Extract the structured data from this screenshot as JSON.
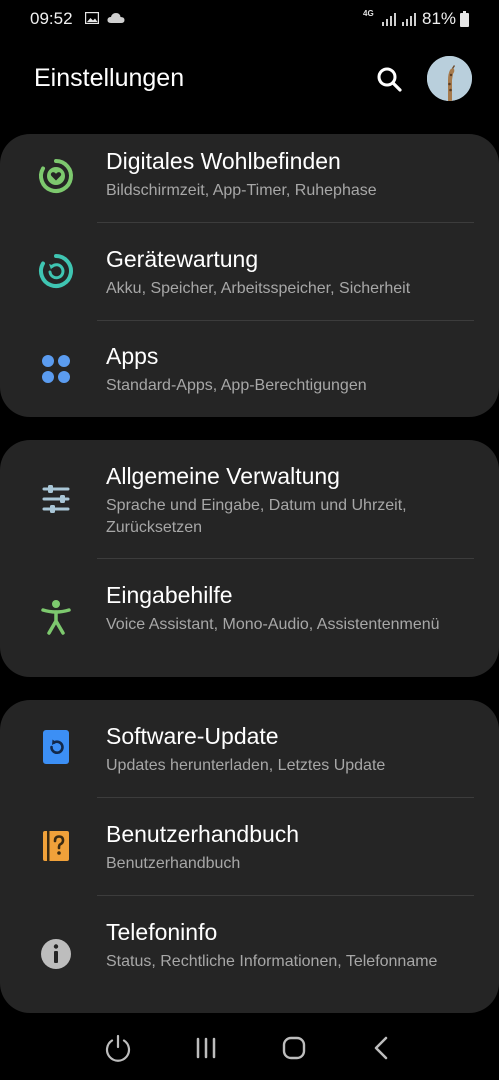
{
  "status_bar": {
    "time": "09:52",
    "network": "4G",
    "battery": "81%",
    "icons": [
      "gallery-icon",
      "cloud-icon",
      "signal-icon",
      "signal-icon",
      "battery-icon"
    ]
  },
  "header": {
    "title": "Einstellungen",
    "search_icon": "search-icon",
    "avatar_icon": "avatar"
  },
  "groups": [
    {
      "items": [
        {
          "icon": "digital-wellbeing-icon",
          "title": "Digitales Wohlbefinden",
          "subtitle": "Bildschirmzeit, App-Timer, Ruhephase",
          "color": "#7dc96e"
        },
        {
          "icon": "device-care-icon",
          "title": "Gerätewartung",
          "subtitle": "Akku, Speicher, Arbeitsspeicher, Sicherheit",
          "color": "#3fc5b2"
        },
        {
          "icon": "apps-icon",
          "title": "Apps",
          "subtitle": "Standard-Apps, App-Berechtigungen",
          "color": "#5b9cf0"
        }
      ]
    },
    {
      "items": [
        {
          "icon": "sliders-icon",
          "title": "Allgemeine Verwaltung",
          "subtitle": "Sprache und Eingabe, Datum und Uhrzeit, Zurücksetzen",
          "color": "#a9c6d6"
        },
        {
          "icon": "accessibility-icon",
          "title": "Eingabehilfe",
          "subtitle": "Voice Assistant, Mono-Audio, Assistentenmenü",
          "color": "#7dc96e"
        }
      ]
    },
    {
      "items": [
        {
          "icon": "software-update-icon",
          "title": "Software-Update",
          "subtitle": "Updates herunterladen, Letztes Update",
          "color": "#3c8ff5"
        },
        {
          "icon": "user-manual-icon",
          "title": "Benutzerhandbuch",
          "subtitle": "Benutzerhandbuch",
          "color": "#f0a13a"
        },
        {
          "icon": "info-icon",
          "title": "Telefoninfo",
          "subtitle": "Status, Rechtliche Informationen, Telefonname",
          "color": "#bdbdbd"
        }
      ]
    }
  ],
  "navbar": {
    "icons": [
      "power-icon",
      "recent-apps-icon",
      "home-icon",
      "back-icon"
    ]
  }
}
